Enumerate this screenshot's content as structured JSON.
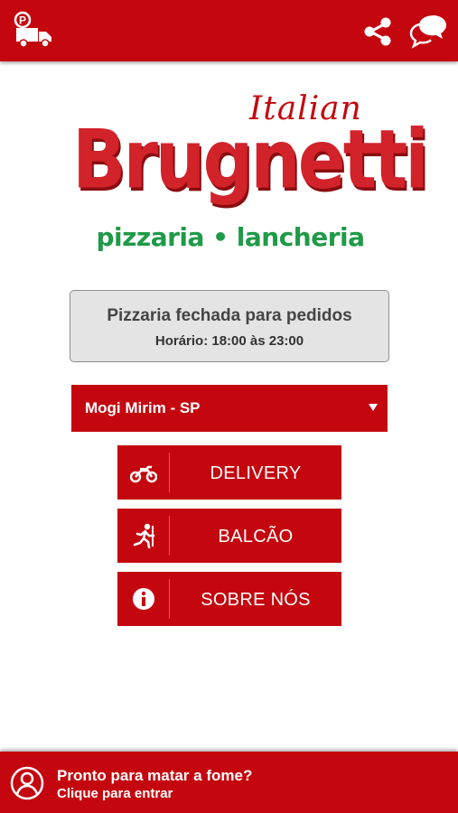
{
  "colors": {
    "brand_red": "#c4070f",
    "logo_red": "#d2222a",
    "logo_green": "#1f9a48",
    "status_bg": "#e4e4e4"
  },
  "topbar": {
    "left_icon": "delivery-truck-icon",
    "right_icons": [
      "share-icon",
      "chat-icon"
    ]
  },
  "logo": {
    "script": "Italian",
    "brand": "Brugnetti",
    "tagline": "pizzaria • lancheria"
  },
  "status": {
    "title": "Pizzaria fechada para pedidos",
    "hours": "Horário: 18:00 às 23:00"
  },
  "city_select": {
    "selected": "Mogi Mirim - SP",
    "caret": "▼"
  },
  "menu": {
    "delivery": {
      "label": "DELIVERY",
      "icon": "motorcycle-icon"
    },
    "balcao": {
      "label": "BALCÃO",
      "icon": "walking-person-icon"
    },
    "sobre": {
      "label": "SOBRE NÓS",
      "icon": "info-icon"
    }
  },
  "footer": {
    "line1": "Pronto para matar a fome?",
    "line2": "Clique para entrar",
    "icon": "user-avatar-icon"
  }
}
